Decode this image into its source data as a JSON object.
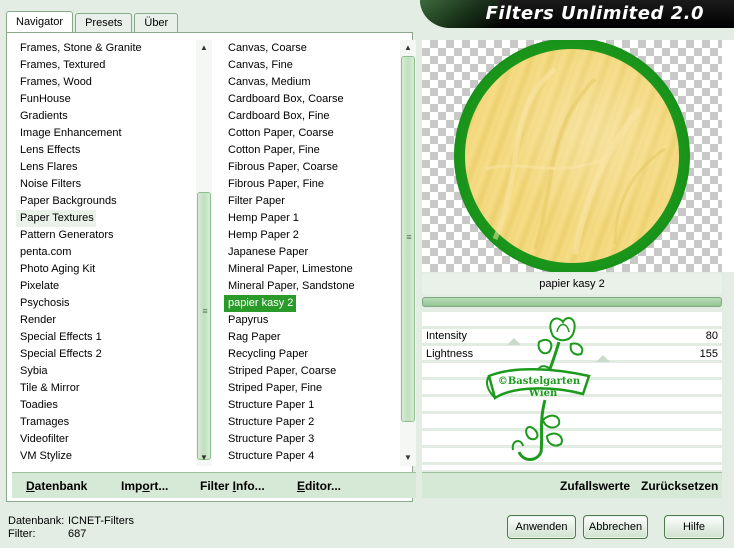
{
  "app": {
    "title": "Filters Unlimited 2.0"
  },
  "tabs": [
    "Navigator",
    "Presets",
    "Über"
  ],
  "categories": {
    "items": [
      "Frames, Stone & Granite",
      "Frames, Textured",
      "Frames, Wood",
      "FunHouse",
      "Gradients",
      "Image Enhancement",
      "Lens Effects",
      "Lens Flares",
      "Noise Filters",
      "Paper Backgrounds",
      "Paper Textures",
      "Pattern Generators",
      "penta.com",
      "Photo Aging Kit",
      "Pixelate",
      "Psychosis",
      "Render",
      "Special Effects 1",
      "Special Effects 2",
      "Sybia",
      "Tile & Mirror",
      "Toadies",
      "Tramages",
      "Videofilter",
      "VM Stylize"
    ],
    "selected": "Paper Textures"
  },
  "filters": {
    "items": [
      "Canvas, Coarse",
      "Canvas, Fine",
      "Canvas, Medium",
      "Cardboard Box, Coarse",
      "Cardboard Box, Fine",
      "Cotton Paper, Coarse",
      "Cotton Paper, Fine",
      "Fibrous Paper, Coarse",
      "Fibrous Paper, Fine",
      "Filter Paper",
      "Hemp Paper 1",
      "Hemp Paper 2",
      "Japanese Paper",
      "Mineral Paper, Limestone",
      "Mineral Paper, Sandstone",
      "papier kasy 2",
      "Papyrus",
      "Rag Paper",
      "Recycling Paper",
      "Striped Paper, Coarse",
      "Striped Paper, Fine",
      "Structure Paper 1",
      "Structure Paper 2",
      "Structure Paper 3",
      "Structure Paper 4"
    ],
    "selected": "papier kasy 2"
  },
  "left_bottom_buttons": {
    "datenbank": {
      "hot": "D",
      "rest": "atenbank"
    },
    "import": {
      "pre": "Imp",
      "hot": "o",
      "rest": "rt..."
    },
    "filter_info": {
      "pre": "Filter ",
      "hot": "I",
      "rest": "nfo..."
    },
    "editor": {
      "hot": "E",
      "rest": "ditor..."
    }
  },
  "preview": {
    "preset_name": "papier kasy 2",
    "progress": 1.0
  },
  "params": [
    {
      "label": "Intensity",
      "value": "80"
    },
    {
      "label": "Lightness",
      "value": "155"
    }
  ],
  "watermark": {
    "line1": "©Bastelgarten",
    "line2": "Wien"
  },
  "right_bottom_buttons": {
    "random": "Zufallswerte",
    "reset": "Zurücksetzen"
  },
  "footer": {
    "db_label": "Datenbank:",
    "db_value": "ICNET-Filters",
    "filter_label": "Filter:",
    "filter_value": "687"
  },
  "buttons": {
    "apply": "Anwenden",
    "cancel": "Abbrechen",
    "help": "Hilfe"
  },
  "colors": {
    "accent_green": "#2a9b2a",
    "panel_bg": "#e4ede4",
    "circle_ring": "#1c9a1c",
    "circle_fill": "#f4d679"
  }
}
